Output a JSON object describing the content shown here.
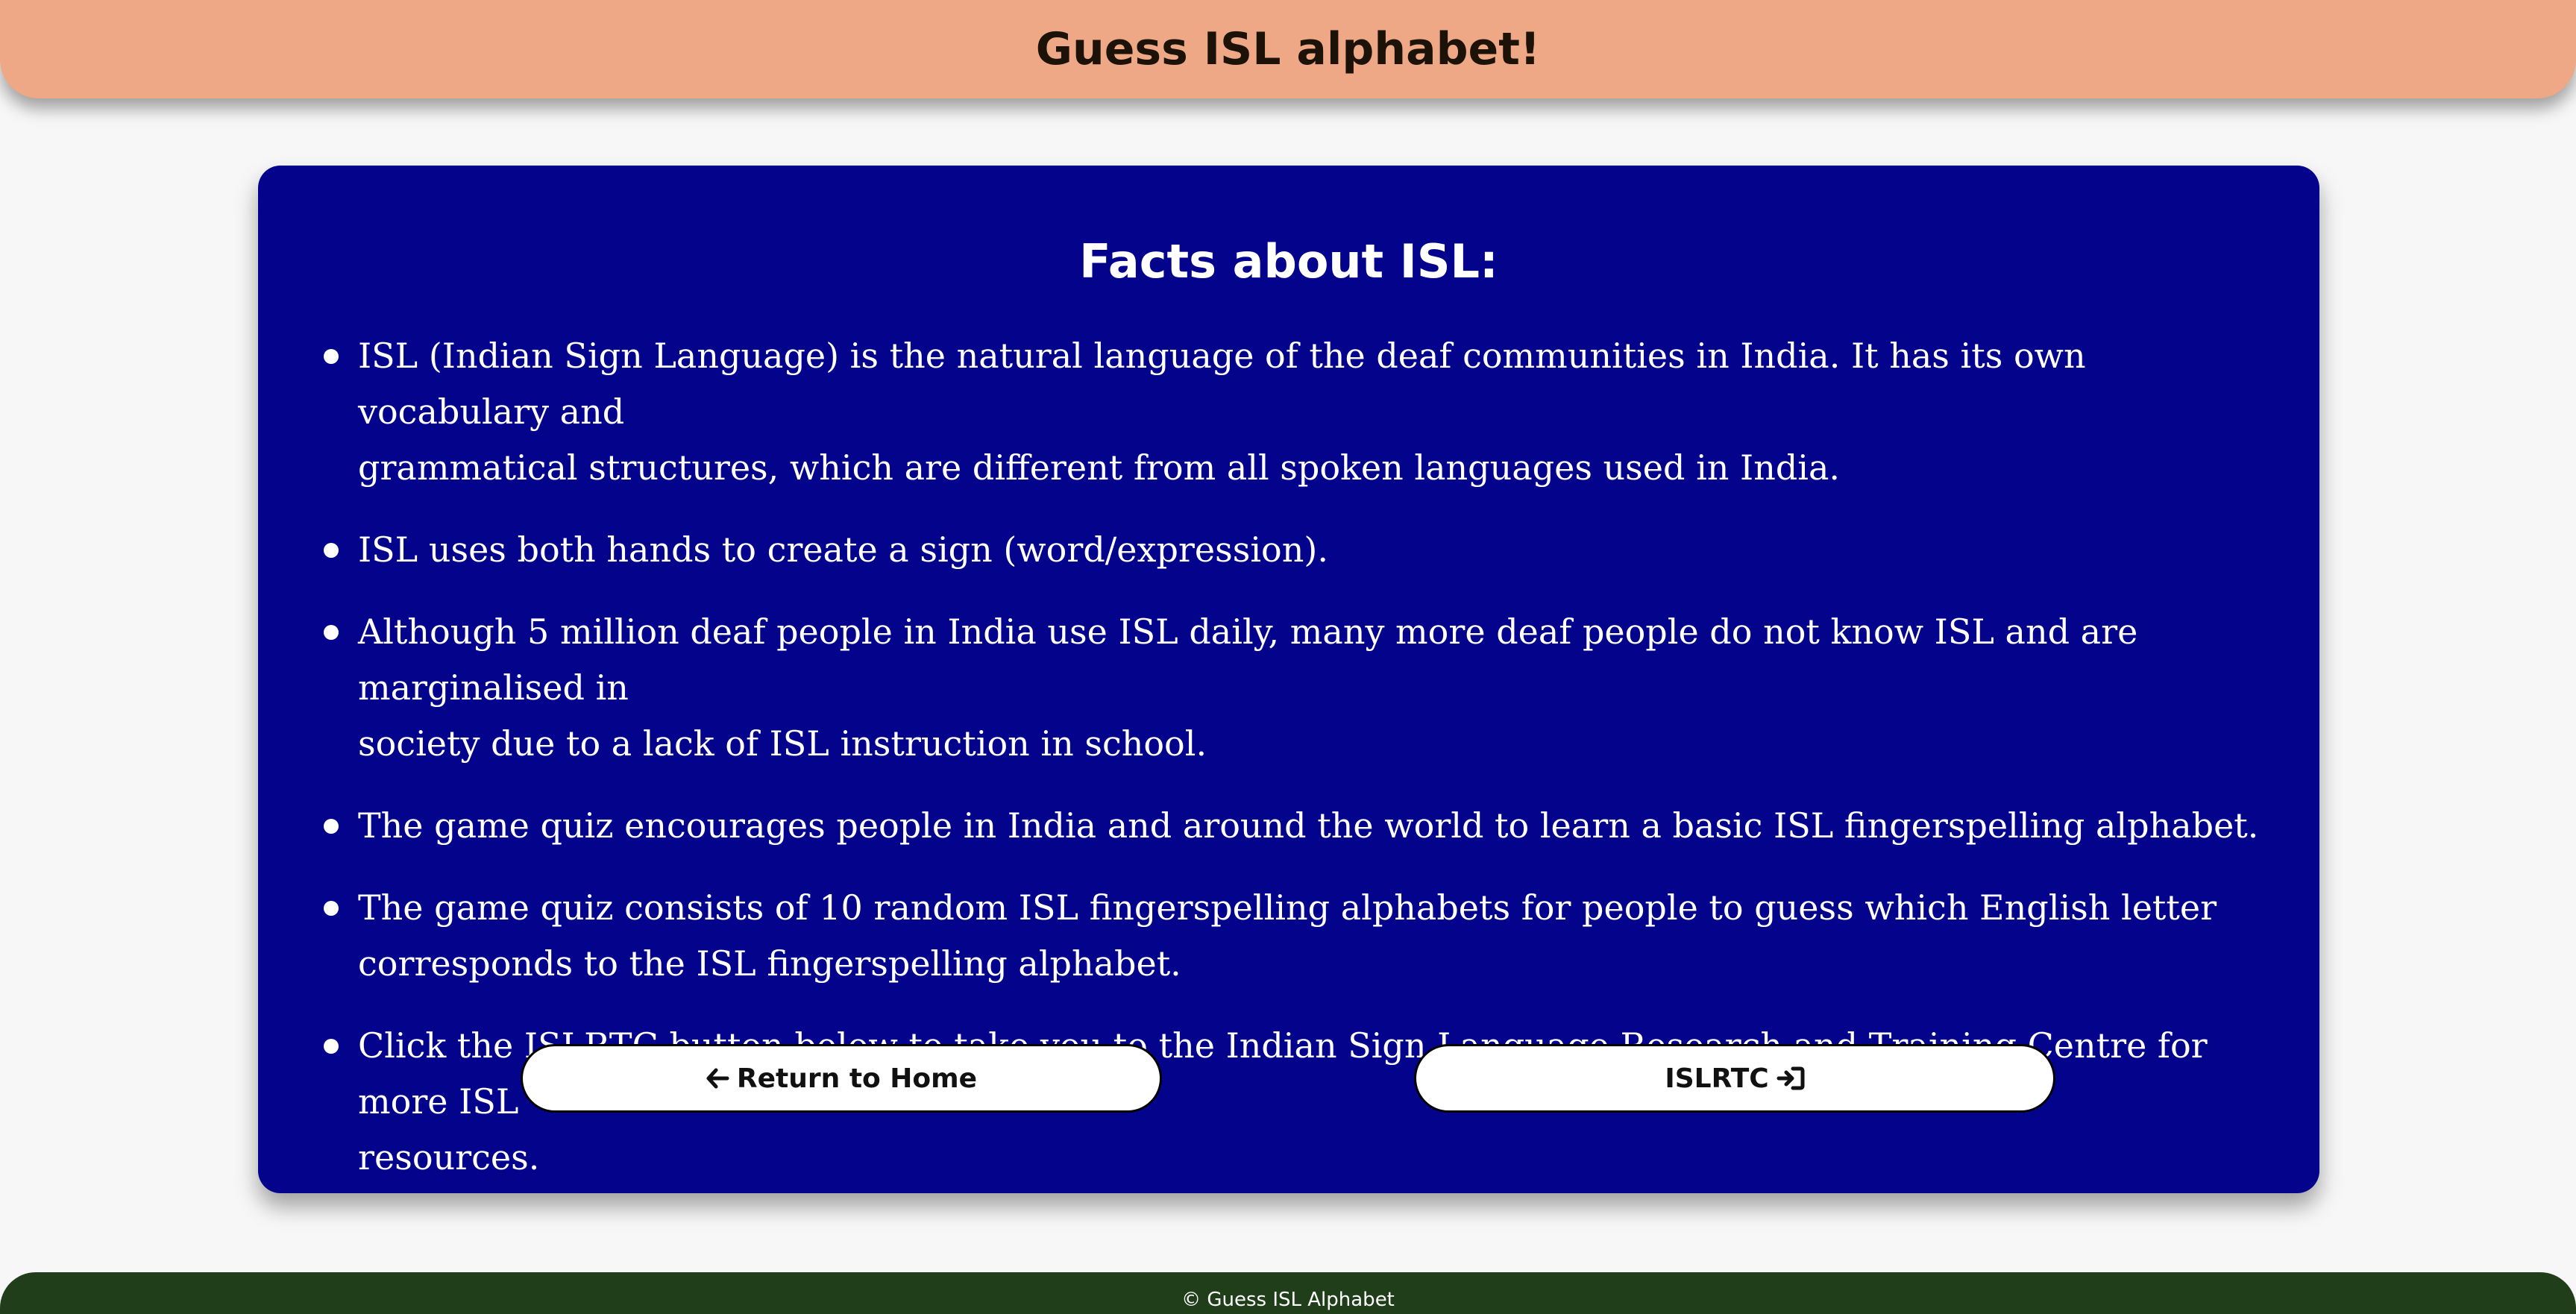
{
  "header": {
    "title": "Guess ISL alphabet!"
  },
  "card": {
    "title": "Facts about ISL:",
    "facts": [
      {
        "line1": "ISL (Indian Sign Language) is the natural language of the deaf communities in India. It has its own vocabulary and",
        "line2": "grammatical structures, which are different from all spoken languages used in India."
      },
      {
        "line1": "ISL uses both hands to create a sign (word/expression).",
        "line2": ""
      },
      {
        "line1": "Although 5 million deaf people in India use ISL daily, many more deaf people do not know ISL and are marginalised in",
        "line2": "society due to a lack of ISL instruction in school."
      },
      {
        "line1": "The game quiz encourages people in India and around the world to learn a basic ISL fingerspelling alphabet.",
        "line2": ""
      },
      {
        "line1": "The game quiz consists of 10 random ISL fingerspelling alphabets for people to guess which English letter",
        "line2": "corresponds to the ISL fingerspelling alphabet."
      },
      {
        "line1": "Click the ISLRTC button below to take you to the Indian Sign Language Research and Training Centre for more ISL",
        "line2": "resources."
      }
    ]
  },
  "buttons": {
    "home_label": "Return to Home",
    "home_icon": "arrow-left-icon",
    "islrtc_label": "ISLRTC",
    "islrtc_icon": "sign-in-icon"
  },
  "footer": {
    "text": "© Guess ISL Alphabet"
  },
  "colors": {
    "header_bg": "#eea885",
    "card_bg": "#04038c",
    "footer_bg": "#213e1b",
    "page_bg": "#f7f7f7"
  }
}
